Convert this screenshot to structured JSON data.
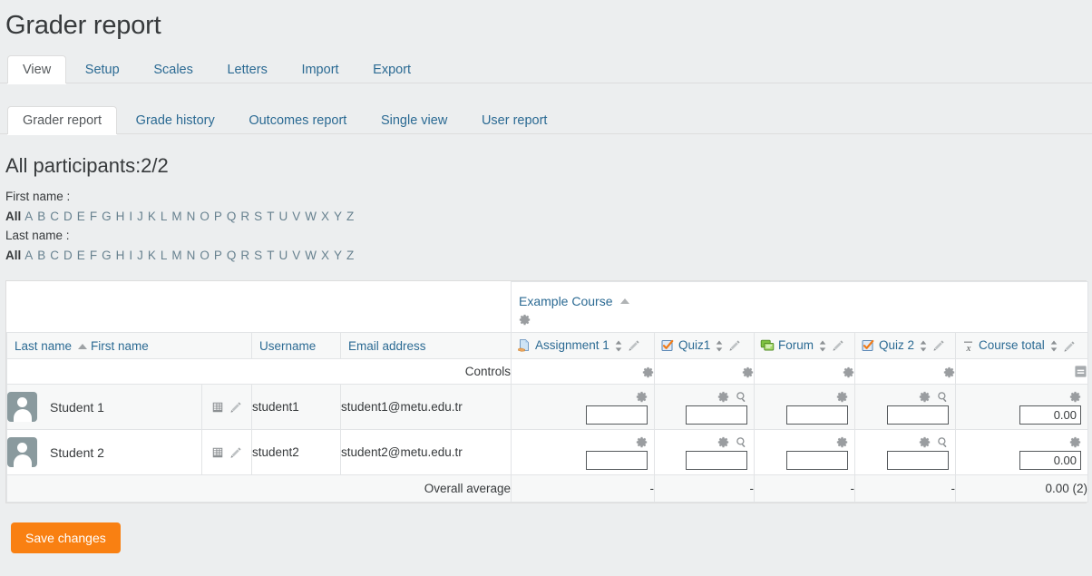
{
  "page": {
    "title": "Grader report",
    "participants_heading": "All participants:2/2"
  },
  "primary_tabs": [
    {
      "label": "View",
      "active": true
    },
    {
      "label": "Setup",
      "active": false
    },
    {
      "label": "Scales",
      "active": false
    },
    {
      "label": "Letters",
      "active": false
    },
    {
      "label": "Import",
      "active": false
    },
    {
      "label": "Export",
      "active": false
    }
  ],
  "secondary_tabs": [
    {
      "label": "Grader report",
      "active": true
    },
    {
      "label": "Grade history",
      "active": false
    },
    {
      "label": "Outcomes report",
      "active": false
    },
    {
      "label": "Single view",
      "active": false
    },
    {
      "label": "User report",
      "active": false
    }
  ],
  "initials": {
    "first_name_label": "First name :",
    "last_name_label": "Last name :",
    "all_label": "All",
    "letters": [
      "A",
      "B",
      "C",
      "D",
      "E",
      "F",
      "G",
      "H",
      "I",
      "J",
      "K",
      "L",
      "M",
      "N",
      "O",
      "P",
      "Q",
      "R",
      "S",
      "T",
      "U",
      "V",
      "W",
      "X",
      "Y",
      "Z"
    ]
  },
  "table": {
    "course_name": "Example Course",
    "course_sort_icon": "sort-asc-icon",
    "course_gear_icon": "gear-icon",
    "headers": {
      "last_name": "Last name",
      "last_name_sort_icon": "sort-asc-icon",
      "first_name": "First name",
      "username": "Username",
      "email_address": "Email address"
    },
    "grade_items": [
      {
        "name": "Assignment 1",
        "icon": "assignment-icon",
        "has_search": false
      },
      {
        "name": "Quiz1",
        "icon": "quiz-icon",
        "has_search": true
      },
      {
        "name": "Forum",
        "icon": "forum-icon",
        "has_search": false
      },
      {
        "name": "Quiz 2",
        "icon": "quiz-icon",
        "has_search": true
      },
      {
        "name": "Course total",
        "icon": "xbar-icon",
        "has_search": false
      }
    ],
    "controls_label": "Controls",
    "controls_hide_icon": "hide-column-icon",
    "students": [
      {
        "name": "Student 1",
        "username": "student1",
        "email": "student1@metu.edu.tr",
        "avatar_icon": "user-avatar-icon",
        "report_icon": "user-report-icon",
        "edit_icon": "pencil-icon",
        "grades": [
          "",
          "",
          "",
          "",
          "0.00"
        ]
      },
      {
        "name": "Student 2",
        "username": "student2",
        "email": "student2@metu.edu.tr",
        "avatar_icon": "user-avatar-icon",
        "report_icon": "user-report-icon",
        "edit_icon": "pencil-icon",
        "grades": [
          "",
          "",
          "",
          "",
          "0.00"
        ]
      }
    ],
    "overall_average": {
      "label": "Overall average",
      "values": [
        "-",
        "-",
        "-",
        "-",
        "0.00 (2)"
      ]
    }
  },
  "save_button": {
    "label": "Save changes",
    "color": "#f98012"
  },
  "colors": {
    "page_background": "#eceeef",
    "link": "#2b6a93",
    "initial_link": "#67818f",
    "row_alt": "#f7f8f8",
    "border": "#e2e4e6",
    "avatar": "#8a9a9e",
    "accent": "#f98012"
  }
}
